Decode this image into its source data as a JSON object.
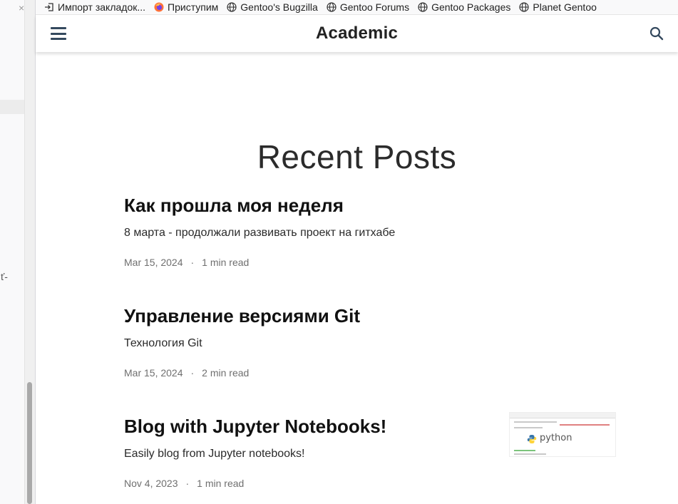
{
  "sidebar": {
    "close_glyph": "×",
    "fragment": "ť-"
  },
  "bookmarks": [
    {
      "label": "Импорт закладок...",
      "icon": "import-icon"
    },
    {
      "label": "Приступим",
      "icon": "firefox-icon"
    },
    {
      "label": "Gentoo's Bugzilla",
      "icon": "globe-icon"
    },
    {
      "label": "Gentoo Forums",
      "icon": "globe-icon"
    },
    {
      "label": "Gentoo Packages",
      "icon": "globe-icon"
    },
    {
      "label": "Planet Gentoo",
      "icon": "globe-icon"
    }
  ],
  "navbar": {
    "brand": "Academic",
    "menu_icon": "hamburger-icon",
    "search_icon": "search-icon"
  },
  "main": {
    "title": "Recent Posts",
    "posts": [
      {
        "title": "Как прошла моя неделя",
        "summary": "8 марта - продолжали развивать проект на гитхабе",
        "date": "Mar 15, 2024",
        "separator": "·",
        "read_time": "1 min read"
      },
      {
        "title": "Управление версиями Git",
        "summary": "Технология Git",
        "date": "Mar 15, 2024",
        "separator": "·",
        "read_time": "2 min read"
      },
      {
        "title": "Blog with Jupyter Notebooks!",
        "summary": "Easily blog from Jupyter notebooks!",
        "date": "Nov 4, 2023",
        "separator": "·",
        "read_time": "1 min read",
        "thumbnail_text": "python"
      }
    ]
  },
  "colors": {
    "accent": "#34495e",
    "text": "#222222",
    "meta": "#6f6f6f"
  }
}
